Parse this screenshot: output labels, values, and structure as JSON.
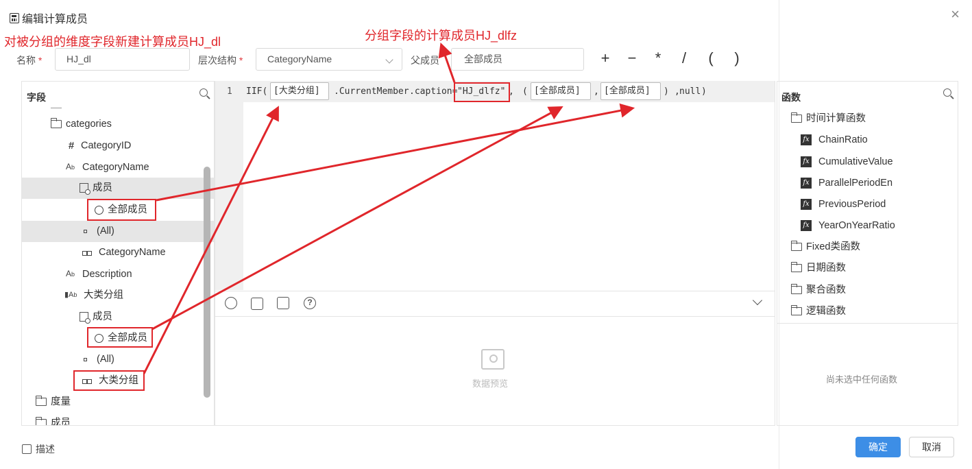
{
  "dialog": {
    "title": "编辑计算成员",
    "close": "×"
  },
  "annotations": {
    "left_note": "对被分组的维度字段新建计算成员HJ_dl",
    "top_note": "分组字段的计算成员HJ_dlfz"
  },
  "form": {
    "name_label": "名称",
    "required_mark": "*",
    "name_value": "HJ_dl",
    "hierarchy_label": "层次结构",
    "hierarchy_value": "CategoryName",
    "parent_label": "父成员",
    "parent_value": "全部成员",
    "operators": [
      "+",
      "−",
      "*",
      "/",
      "(",
      ")"
    ]
  },
  "fields_panel": {
    "title": "字段",
    "items": [
      {
        "label": "categories",
        "icon": "folder-icon"
      },
      {
        "label": "CategoryID",
        "icon": "hash-icon"
      },
      {
        "label": "CategoryName",
        "icon": "text-field-icon"
      },
      {
        "label": "成员",
        "icon": "member-icon"
      },
      {
        "label": "全部成员",
        "icon": "circle-icon"
      },
      {
        "label": "(All)",
        "icon": "level-icon"
      },
      {
        "label": "CategoryName",
        "icon": "level-dots-icon"
      },
      {
        "label": "Description",
        "icon": "text-field-icon"
      },
      {
        "label": "大类分组",
        "icon": "group-field-icon"
      },
      {
        "label": "成员",
        "icon": "member-icon"
      },
      {
        "label": "全部成员",
        "icon": "circle-icon"
      },
      {
        "label": "(All)",
        "icon": "level-icon"
      },
      {
        "label": "大类分组",
        "icon": "level-dots-icon"
      },
      {
        "label": "度量",
        "icon": "folder-icon"
      },
      {
        "label": "成员",
        "icon": "folder-icon"
      }
    ]
  },
  "editor": {
    "line_number": "1",
    "code": {
      "iif": "IIF(",
      "token1": "[大类分组]",
      "member": ".CurrentMember",
      "caption": ".caption=",
      "string": "\"HJ_dlfz\"",
      "comma1": ",",
      "paren": "(",
      "token2": "[全部成员]",
      "comma2": ",",
      "token3": "[全部成员]",
      "close": ")",
      "tail_comma": ",",
      "null": "null",
      "end": ")"
    },
    "preview_label": "数据预览"
  },
  "functions_panel": {
    "title": "函数",
    "time_folder": "时间计算函数",
    "time_functions": [
      "ChainRatio",
      "CumulativeValue",
      "ParallelPeriodEn",
      "PreviousPeriod",
      "YearOnYearRatio"
    ],
    "folders": [
      "Fixed类函数",
      "日期函数",
      "聚合函数",
      "逻辑函数"
    ],
    "empty_text": "尚未选中任何函数"
  },
  "footer": {
    "describe_label": "描述",
    "confirm": "确定",
    "cancel": "取消"
  },
  "colors": {
    "primary": "#3d8ee6",
    "annotation_red": "#e0262b"
  }
}
